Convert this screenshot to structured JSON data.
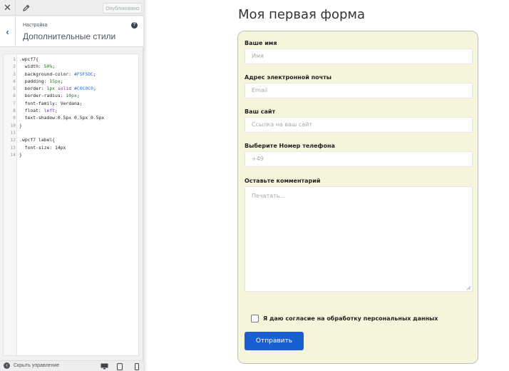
{
  "toolbar": {
    "close_icon": "close-icon",
    "edit_icon": "pencil-icon",
    "publish_label": "Опубликовано"
  },
  "section": {
    "breadcrumb": "Настройка",
    "title": "Дополнительные стили",
    "help_icon": "help-icon"
  },
  "css_lines": [
    {
      "n": "1",
      "parts": [
        [
          ".wpcf7{",
          ""
        ]
      ]
    },
    {
      "n": "2",
      "parts": [
        [
          "  width: ",
          ""
        ],
        [
          "50%",
          "num"
        ],
        [
          ";",
          ""
        ]
      ]
    },
    {
      "n": "3",
      "parts": [
        [
          "  background-color: ",
          ""
        ],
        [
          "#F5F5DC",
          "hex"
        ],
        [
          ";",
          ""
        ]
      ]
    },
    {
      "n": "4",
      "parts": [
        [
          "  padding: ",
          ""
        ],
        [
          "15px",
          "num"
        ],
        [
          ";",
          ""
        ]
      ]
    },
    {
      "n": "5",
      "parts": [
        [
          "  border: ",
          ""
        ],
        [
          "1px",
          "num"
        ],
        [
          " ",
          ""
        ],
        [
          "solid",
          "kw"
        ],
        [
          " ",
          ""
        ],
        [
          "#C0C0C0",
          "hex"
        ],
        [
          ";",
          ""
        ]
      ]
    },
    {
      "n": "6",
      "parts": [
        [
          "  border-radius: ",
          ""
        ],
        [
          "10px",
          "num"
        ],
        [
          ";",
          ""
        ]
      ]
    },
    {
      "n": "7",
      "parts": [
        [
          "  font-family: Verdana;",
          ""
        ]
      ]
    },
    {
      "n": "8",
      "parts": [
        [
          "  float: ",
          ""
        ],
        [
          "left",
          "kw"
        ],
        [
          ";",
          ""
        ]
      ]
    },
    {
      "n": "9",
      "parts": [
        [
          "  text-shadow:0.5px 0.5px 0.5px",
          ""
        ]
      ]
    },
    {
      "n": "10",
      "parts": [
        [
          "}",
          ""
        ]
      ]
    },
    {
      "n": "11",
      "parts": [
        [
          "",
          ""
        ]
      ]
    },
    {
      "n": "12",
      "parts": [
        [
          ".wpcf7 label{",
          ""
        ]
      ]
    },
    {
      "n": "13",
      "parts": [
        [
          "  font-size: 14px",
          ""
        ]
      ]
    },
    {
      "n": "14",
      "parts": [
        [
          "}",
          ""
        ]
      ]
    }
  ],
  "bottom": {
    "collapse_label": "Скрыть управление",
    "devices": [
      "desktop-icon",
      "tablet-icon",
      "mobile-icon"
    ]
  },
  "preview": {
    "title": "Моя первая форма",
    "fields": [
      {
        "label": "Ваше имя",
        "placeholder": "Имя"
      },
      {
        "label": "Адрес электронной почты",
        "placeholder": "Email"
      },
      {
        "label": "Ваш сайт",
        "placeholder": "Ссылка на ваш сайт"
      },
      {
        "label": "Выберите Номер телефона",
        "placeholder": "+49"
      }
    ],
    "comment_label": "Оставьте комментарий",
    "comment_placeholder": "Печатать...",
    "consent_label": "Я даю согласие на обработку персональных данных",
    "submit_label": "Отправить"
  },
  "colors": {
    "form_bg": "#F5F5DC",
    "form_border": "#C0C0C0",
    "submit_bg": "#1a5fd1",
    "accent": "#2271b1"
  }
}
